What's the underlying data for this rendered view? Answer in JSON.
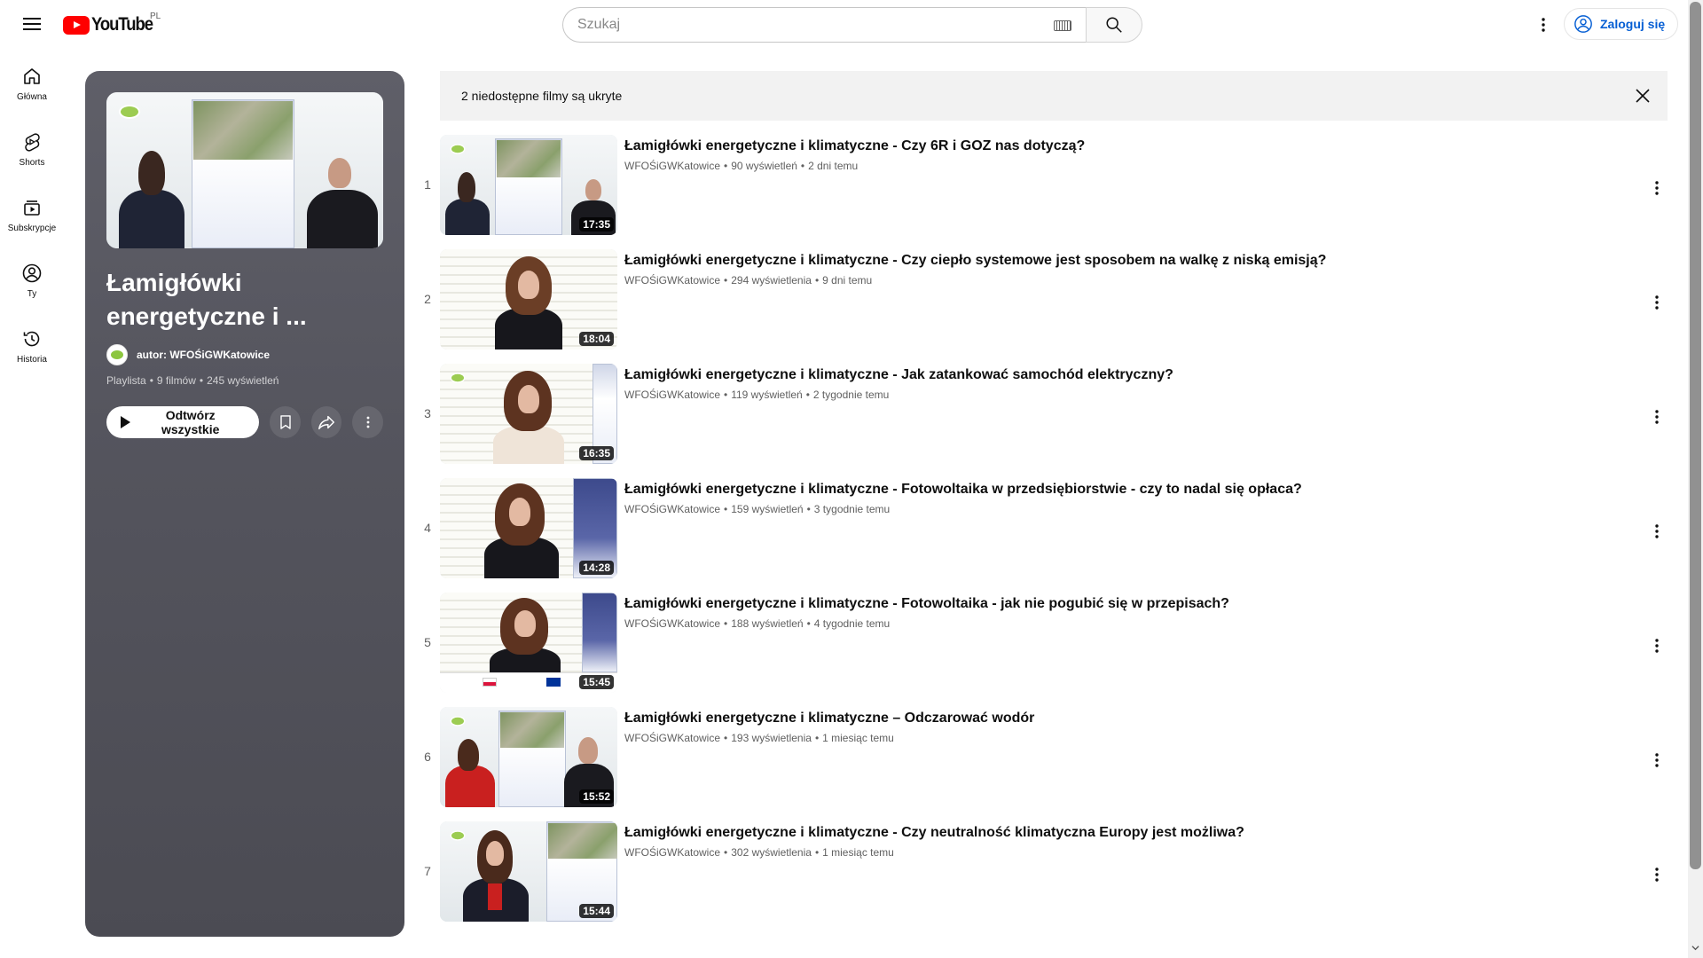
{
  "masthead": {
    "logo_text": "YouTube",
    "country": "PL",
    "search_placeholder": "Szukaj",
    "signin_label": "Zaloguj się"
  },
  "guide": [
    {
      "label": "Główna",
      "icon": "home-icon"
    },
    {
      "label": "Shorts",
      "icon": "shorts-icon"
    },
    {
      "label": "Subskrypcje",
      "icon": "subscriptions-icon"
    },
    {
      "label": "Ty",
      "icon": "you-icon"
    },
    {
      "label": "Historia",
      "icon": "history-icon"
    }
  ],
  "playlist": {
    "title": "Łamigłówki energetyczne i ...",
    "owner": "autor: WFOŚiGWKatowice",
    "type": "Playlista",
    "count": "9 filmów",
    "views": "245 wyświetleń",
    "play_all_label": "Odtwórz wszystkie"
  },
  "banner": {
    "text": "2 niedostępne filmy są ukryte"
  },
  "videos": [
    {
      "index": "1",
      "title": "Łamigłówki energetyczne i klimatyczne - Czy 6R i GOZ nas dotyczą?",
      "channel": "WFOŚiGWKatowice",
      "views": "90 wyświetleń",
      "age": "2 dni temu",
      "duration": "17:35"
    },
    {
      "index": "2",
      "title": "Łamigłówki energetyczne i klimatyczne - Czy ciepło systemowe jest sposobem na walkę z niską emisją?",
      "channel": "WFOŚiGWKatowice",
      "views": "294 wyświetlenia",
      "age": "9 dni temu",
      "duration": "18:04"
    },
    {
      "index": "3",
      "title": "Łamigłówki energetyczne i klimatyczne - Jak zatankować samochód elektryczny?",
      "channel": "WFOŚiGWKatowice",
      "views": "119 wyświetleń",
      "age": "2 tygodnie temu",
      "duration": "16:35"
    },
    {
      "index": "4",
      "title": "Łamigłówki energetyczne i klimatyczne - Fotowoltaika w przedsiębiorstwie - czy to nadal się opłaca?",
      "channel": "WFOŚiGWKatowice",
      "views": "159 wyświetleń",
      "age": "3 tygodnie temu",
      "duration": "14:28"
    },
    {
      "index": "5",
      "title": "Łamigłówki energetyczne i klimatyczne - Fotowoltaika - jak nie pogubić się w przepisach?",
      "channel": "WFOŚiGWKatowice",
      "views": "188 wyświetleń",
      "age": "4 tygodnie temu",
      "duration": "15:45"
    },
    {
      "index": "6",
      "title": "Łamigłówki energetyczne i klimatyczne – Odczarować wodór",
      "channel": "WFOŚiGWKatowice",
      "views": "193 wyświetlenia",
      "age": "1 miesiąc temu",
      "duration": "15:52"
    },
    {
      "index": "7",
      "title": "Łamigłówki energetyczne i klimatyczne - Czy neutralność klimatyczna Europy jest możliwa?",
      "channel": "WFOŚiGWKatowice",
      "views": "302 wyświetlenia",
      "age": "1 miesiąc temu",
      "duration": "15:44"
    }
  ],
  "colors": {
    "brand_red": "#ff0000",
    "link_blue": "#065fd4",
    "panel_gray": "#56565f",
    "banner_bg": "#f2f2f2"
  }
}
